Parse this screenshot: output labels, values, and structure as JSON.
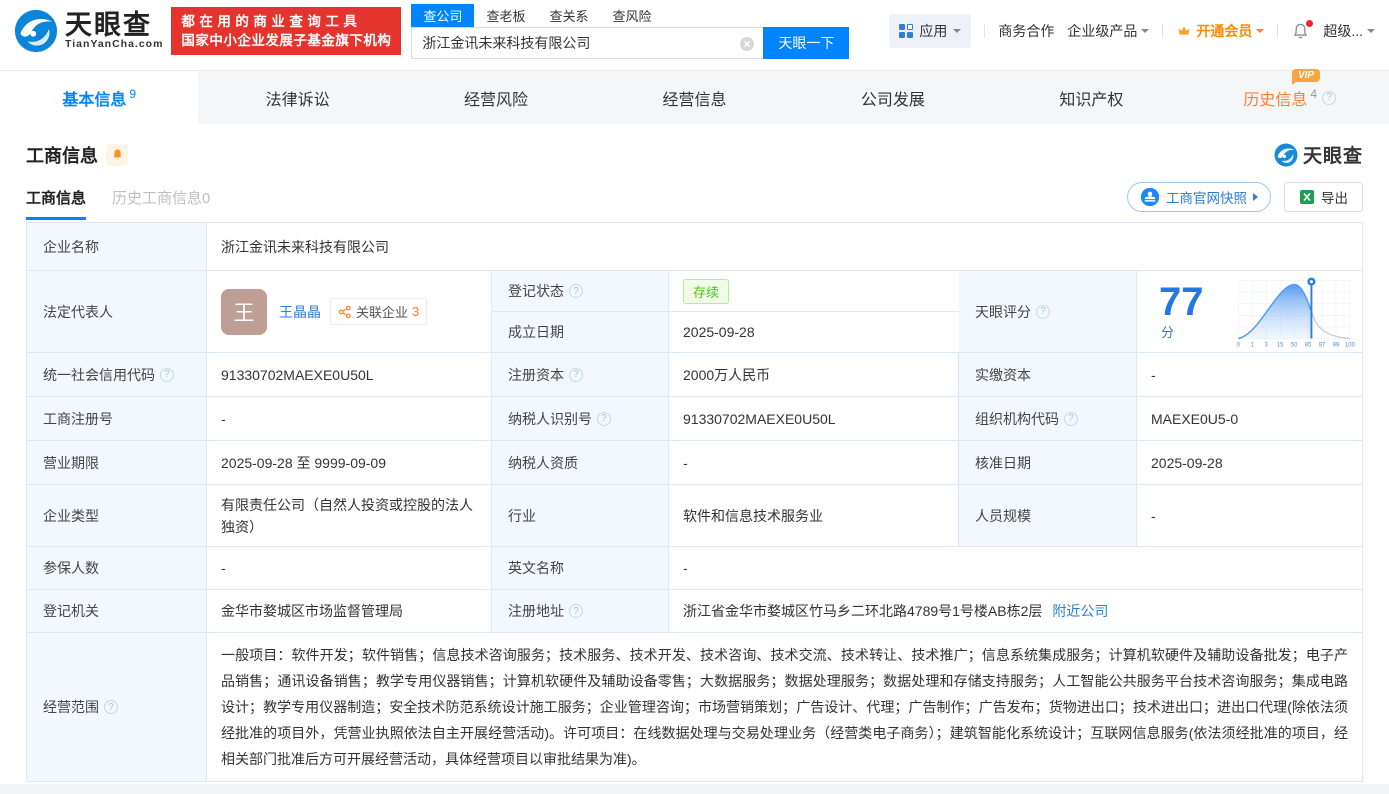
{
  "colors": {
    "brand_blue": "#0084ff",
    "link_blue": "#2b7fd4",
    "banner_red": "#e5342e",
    "vip_orange": "#f9a43c",
    "history_orange": "#ff7e33",
    "status_green": "#52c41a",
    "score_blue": "#2178e5"
  },
  "icons": {
    "help_glyph": "?"
  },
  "header": {
    "logo": {
      "brand": "天眼查",
      "domain": "TianYanCha.com"
    },
    "banner": {
      "line1": "都在用的商业查询工具",
      "line2": "国家中小企业发展子基金旗下机构"
    },
    "search": {
      "tabs": [
        {
          "label": "查公司",
          "active": true
        },
        {
          "label": "查老板",
          "active": false
        },
        {
          "label": "查关系",
          "active": false
        },
        {
          "label": "查风险",
          "active": false
        }
      ],
      "value": "浙江金讯未来科技有限公司",
      "button": "天眼一下"
    },
    "menu": {
      "apps": "应用",
      "business": "商务合作",
      "enterprise": "企业级产品",
      "vip": "开通会员",
      "super": "超级..."
    }
  },
  "nav": {
    "tabs": [
      {
        "label": "基本信息",
        "count": "9"
      },
      {
        "label": "法律诉讼",
        "count": ""
      },
      {
        "label": "经营风险",
        "count": ""
      },
      {
        "label": "经营信息",
        "count": ""
      },
      {
        "label": "公司发展",
        "count": ""
      },
      {
        "label": "知识产权",
        "count": ""
      },
      {
        "label": "历史信息",
        "count": "4",
        "vip_badge": "VIP"
      }
    ]
  },
  "section": {
    "title": "工商信息",
    "watermark_brand": "天眼查",
    "sub_tabs": [
      {
        "label": "工商信息",
        "active": true
      },
      {
        "label": "历史工商信息0",
        "active": false
      }
    ],
    "snapshot_button": "工商官网快照",
    "export_button": "导出"
  },
  "table": {
    "company_name": {
      "label": "企业名称",
      "value": "浙江金讯未来科技有限公司"
    },
    "legal_rep": {
      "label": "法定代表人",
      "avatar_char": "王",
      "name": "王晶晶",
      "related_label": "关联企业",
      "related_count": "3"
    },
    "reg_status": {
      "label": "登记状态",
      "value": "存续"
    },
    "establish_date": {
      "label": "成立日期",
      "value": "2025-09-28"
    },
    "score": {
      "label": "天眼评分",
      "value": "77",
      "unit": "分",
      "ticks": [
        "0",
        "1",
        "3",
        "15",
        "50",
        "85",
        "97",
        "99",
        "100"
      ]
    },
    "rows": [
      {
        "c1": {
          "label": "统一社会信用代码",
          "value": "91330702MAEXE0U50L"
        },
        "c2": {
          "label": "注册资本",
          "value": "2000万人民币"
        },
        "c3": {
          "label": "实缴资本",
          "value": "-"
        }
      },
      {
        "c1": {
          "label": "工商注册号",
          "value": "-"
        },
        "c2": {
          "label": "纳税人识别号",
          "value": "91330702MAEXE0U50L"
        },
        "c3": {
          "label": "组织机构代码",
          "value": "MAEXE0U5-0"
        }
      },
      {
        "c1": {
          "label": "营业期限",
          "value": "2025-09-28 至 9999-09-09"
        },
        "c2": {
          "label": "纳税人资质",
          "value": "-"
        },
        "c3": {
          "label": "核准日期",
          "value": "2025-09-28"
        }
      },
      {
        "c1": {
          "label": "企业类型",
          "value": "有限责任公司（自然人投资或控股的法人独资）"
        },
        "c2": {
          "label": "行业",
          "value": "软件和信息技术服务业"
        },
        "c3": {
          "label": "人员规模",
          "value": "-"
        }
      }
    ],
    "insured": {
      "label": "参保人数",
      "value": "-"
    },
    "english_name": {
      "label": "英文名称",
      "value": "-"
    },
    "registry": {
      "label": "登记机关",
      "value": "金华市婺城区市场监督管理局"
    },
    "address": {
      "label": "注册地址",
      "value": "浙江省金华市婺城区竹马乡二环北路4789号1号楼AB栋2层",
      "nearby_link": "附近公司"
    },
    "scope": {
      "label": "经营范围",
      "value": "一般项目：软件开发；软件销售；信息技术咨询服务；技术服务、技术开发、技术咨询、技术交流、技术转让、技术推广；信息系统集成服务；计算机软硬件及辅助设备批发；电子产品销售；通讯设备销售；教学专用仪器销售；计算机软硬件及辅助设备零售；大数据服务；数据处理服务；数据处理和存储支持服务；人工智能公共服务平台技术咨询服务；集成电路设计；教学专用仪器制造；安全技术防范系统设计施工服务；企业管理咨询；市场营销策划；广告设计、代理；广告制作；广告发布；货物进出口；技术进出口；进出口代理(除依法须经批准的项目外，凭营业执照依法自主开展经营活动)。许可项目：在线数据处理与交易处理业务（经营类电子商务）；建筑智能化系统设计；互联网信息服务(依法须经批准的项目，经相关部门批准后方可开展经营活动，具体经营项目以审批结果为准)。"
    }
  }
}
